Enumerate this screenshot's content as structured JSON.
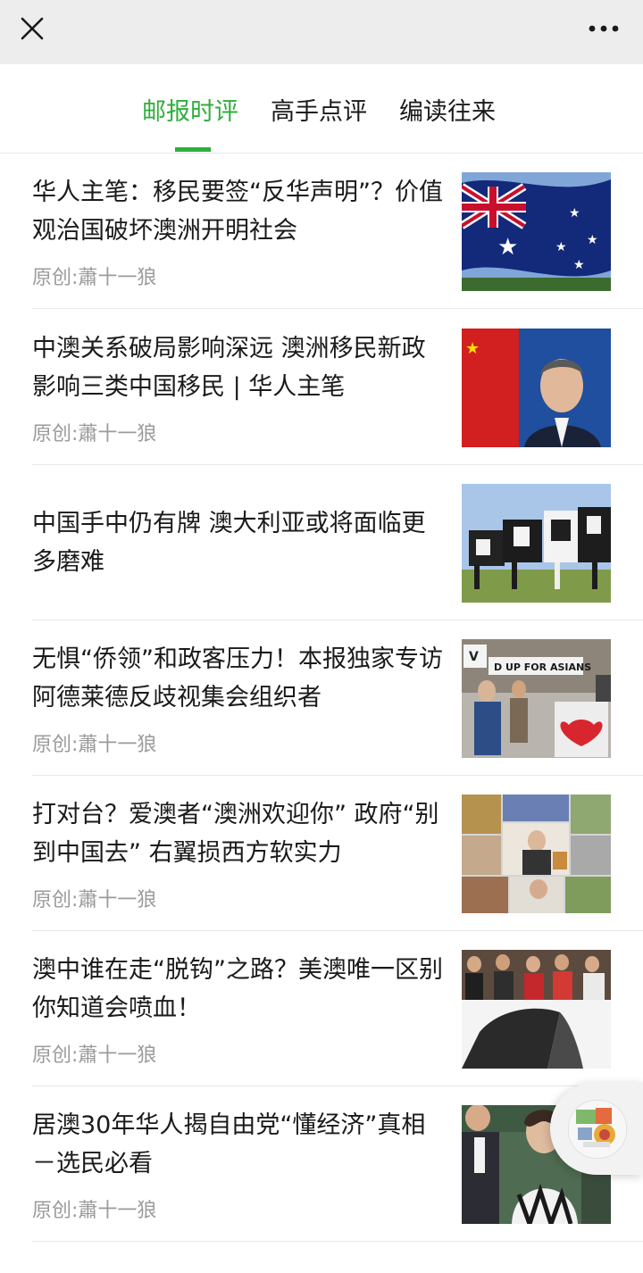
{
  "tabs": [
    {
      "label": "邮报时评",
      "active": true
    },
    {
      "label": "高手点评",
      "active": false
    },
    {
      "label": "编读往来",
      "active": false
    }
  ],
  "articles": [
    {
      "title": "华人主笔：移民要签“反华声明”？价值观治国破坏澳洲开明社会",
      "source": "原创:蕭十一狼",
      "thumb": "australian-flag"
    },
    {
      "title": "中澳关系破局影响深远 澳洲移民新政影响三类中国移民 | 华人主笔",
      "source": "原创:蕭十一狼",
      "thumb": "spokesman-flag"
    },
    {
      "title": "中国手中仍有牌 澳大利亚或将面临更多磨难",
      "source": "",
      "thumb": "cows"
    },
    {
      "title": "无惧“侨领”和政客压力！本报独家专访阿德莱德反歧视集会组织者",
      "source": "原创:蕭十一狼",
      "thumb": "rally"
    },
    {
      "title": "打对台？爱澳者“澳洲欢迎你” 政府“别到中国去” 右翼损西方软实力",
      "source": "原创:蕭十一狼",
      "thumb": "collage"
    },
    {
      "title": "澳中谁在走“脱钩”之路？美澳唯一区别你知道会喷血！",
      "source": "原创:蕭十一狼",
      "thumb": "crowd-opera"
    },
    {
      "title": "居澳30年华人揭自由党“懂经济”真相－选民必看",
      "source": "原创:蕭十一狼",
      "thumb": "parliament"
    }
  ]
}
